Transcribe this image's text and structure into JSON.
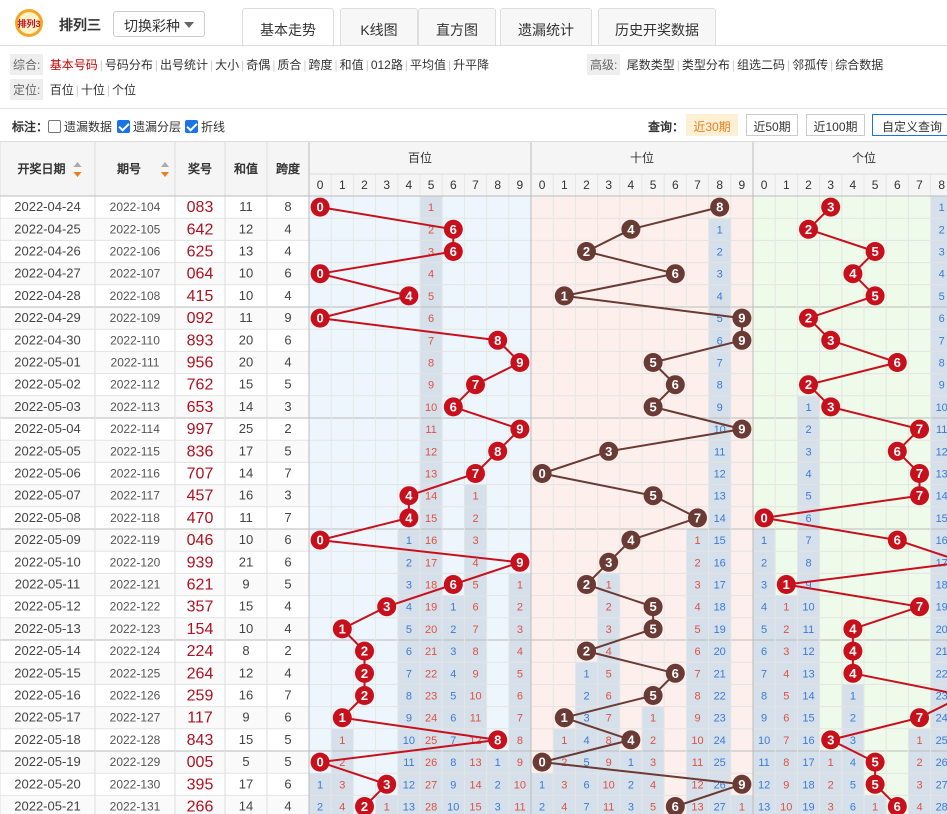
{
  "header": {
    "logo_text": "排列3",
    "lottery_name": "排列三",
    "switch_label": "切换彩种",
    "tabs": [
      "基本走势",
      "K线图",
      "直方图",
      "遗漏统计",
      "历史开奖数据"
    ]
  },
  "filters": {
    "zonghe_label": "综合:",
    "zonghe_items": [
      "基本号码",
      "号码分布",
      "出号统计",
      "大小",
      "奇偶",
      "质合",
      "跨度",
      "和值",
      "012路",
      "平均值",
      "升平降"
    ],
    "advanced_label": "高级:",
    "advanced_items": [
      "尾数类型",
      "类型分布",
      "组选二码",
      "邻孤传",
      "综合数据"
    ],
    "position_label": "定位:",
    "position_items": [
      "百位",
      "十位",
      "个位"
    ]
  },
  "mark_bar": {
    "label": "标注：",
    "checkboxes": [
      {
        "label": "遗漏数据",
        "checked": false
      },
      {
        "label": "遗漏分层",
        "checked": true
      },
      {
        "label": "折线",
        "checked": true
      }
    ],
    "query_label": "查询：",
    "query_buttons": [
      "近30期",
      "近50期",
      "近100期",
      "自定义查询"
    ]
  },
  "table": {
    "headers": {
      "date": "开奖日期",
      "issue": "期号",
      "number": "奖号",
      "sum": "和值",
      "span": "跨度",
      "groups": [
        "百位",
        "十位",
        "个位"
      ]
    },
    "digits": [
      "0",
      "1",
      "2",
      "3",
      "4",
      "5",
      "6",
      "7",
      "8",
      "9"
    ],
    "rows": [
      {
        "date": "2022-04-24",
        "issue": "2022-104",
        "num": "083",
        "sum": "11",
        "span": "8"
      },
      {
        "date": "2022-04-25",
        "issue": "2022-105",
        "num": "642",
        "sum": "12",
        "span": "4"
      },
      {
        "date": "2022-04-26",
        "issue": "2022-106",
        "num": "625",
        "sum": "13",
        "span": "4"
      },
      {
        "date": "2022-04-27",
        "issue": "2022-107",
        "num": "064",
        "sum": "10",
        "span": "6"
      },
      {
        "date": "2022-04-28",
        "issue": "2022-108",
        "num": "415",
        "sum": "10",
        "span": "4"
      },
      {
        "date": "2022-04-29",
        "issue": "2022-109",
        "num": "092",
        "sum": "11",
        "span": "9"
      },
      {
        "date": "2022-04-30",
        "issue": "2022-110",
        "num": "893",
        "sum": "20",
        "span": "6"
      },
      {
        "date": "2022-05-01",
        "issue": "2022-111",
        "num": "956",
        "sum": "20",
        "span": "4"
      },
      {
        "date": "2022-05-02",
        "issue": "2022-112",
        "num": "762",
        "sum": "15",
        "span": "5"
      },
      {
        "date": "2022-05-03",
        "issue": "2022-113",
        "num": "653",
        "sum": "14",
        "span": "3"
      },
      {
        "date": "2022-05-04",
        "issue": "2022-114",
        "num": "997",
        "sum": "25",
        "span": "2"
      },
      {
        "date": "2022-05-05",
        "issue": "2022-115",
        "num": "836",
        "sum": "17",
        "span": "5"
      },
      {
        "date": "2022-05-06",
        "issue": "2022-116",
        "num": "707",
        "sum": "14",
        "span": "7"
      },
      {
        "date": "2022-05-07",
        "issue": "2022-117",
        "num": "457",
        "sum": "16",
        "span": "3"
      },
      {
        "date": "2022-05-08",
        "issue": "2022-118",
        "num": "470",
        "sum": "11",
        "span": "7"
      },
      {
        "date": "2022-05-09",
        "issue": "2022-119",
        "num": "046",
        "sum": "10",
        "span": "6"
      },
      {
        "date": "2022-05-10",
        "issue": "2022-120",
        "num": "939",
        "sum": "21",
        "span": "6"
      },
      {
        "date": "2022-05-11",
        "issue": "2022-121",
        "num": "621",
        "sum": "9",
        "span": "5"
      },
      {
        "date": "2022-05-12",
        "issue": "2022-122",
        "num": "357",
        "sum": "15",
        "span": "4"
      },
      {
        "date": "2022-05-13",
        "issue": "2022-123",
        "num": "154",
        "sum": "10",
        "span": "4"
      },
      {
        "date": "2022-05-14",
        "issue": "2022-124",
        "num": "224",
        "sum": "8",
        "span": "2"
      },
      {
        "date": "2022-05-15",
        "issue": "2022-125",
        "num": "264",
        "sum": "12",
        "span": "4"
      },
      {
        "date": "2022-05-16",
        "issue": "2022-126",
        "num": "259",
        "sum": "16",
        "span": "7"
      },
      {
        "date": "2022-05-17",
        "issue": "2022-127",
        "num": "117",
        "sum": "9",
        "span": "6"
      },
      {
        "date": "2022-05-18",
        "issue": "2022-128",
        "num": "843",
        "sum": "15",
        "span": "5"
      },
      {
        "date": "2022-05-19",
        "issue": "2022-129",
        "num": "005",
        "sum": "5",
        "span": "5"
      },
      {
        "date": "2022-05-20",
        "issue": "2022-130",
        "num": "395",
        "sum": "17",
        "span": "6"
      },
      {
        "date": "2022-05-21",
        "issue": "2022-131",
        "num": "266",
        "sum": "14",
        "span": "4"
      }
    ]
  },
  "colors": {
    "bai_ball": "#c8101c",
    "shi_ball": "#6a3a35",
    "ge_ball": "#c8101c",
    "bai_bg": "#eef6fd",
    "shi_bg": "#fdf0ec",
    "ge_bg": "#eefbea",
    "layer_bg": "#d6e0ea",
    "miss_blue": "#3a7bd5",
    "miss_red": "#e05040"
  }
}
